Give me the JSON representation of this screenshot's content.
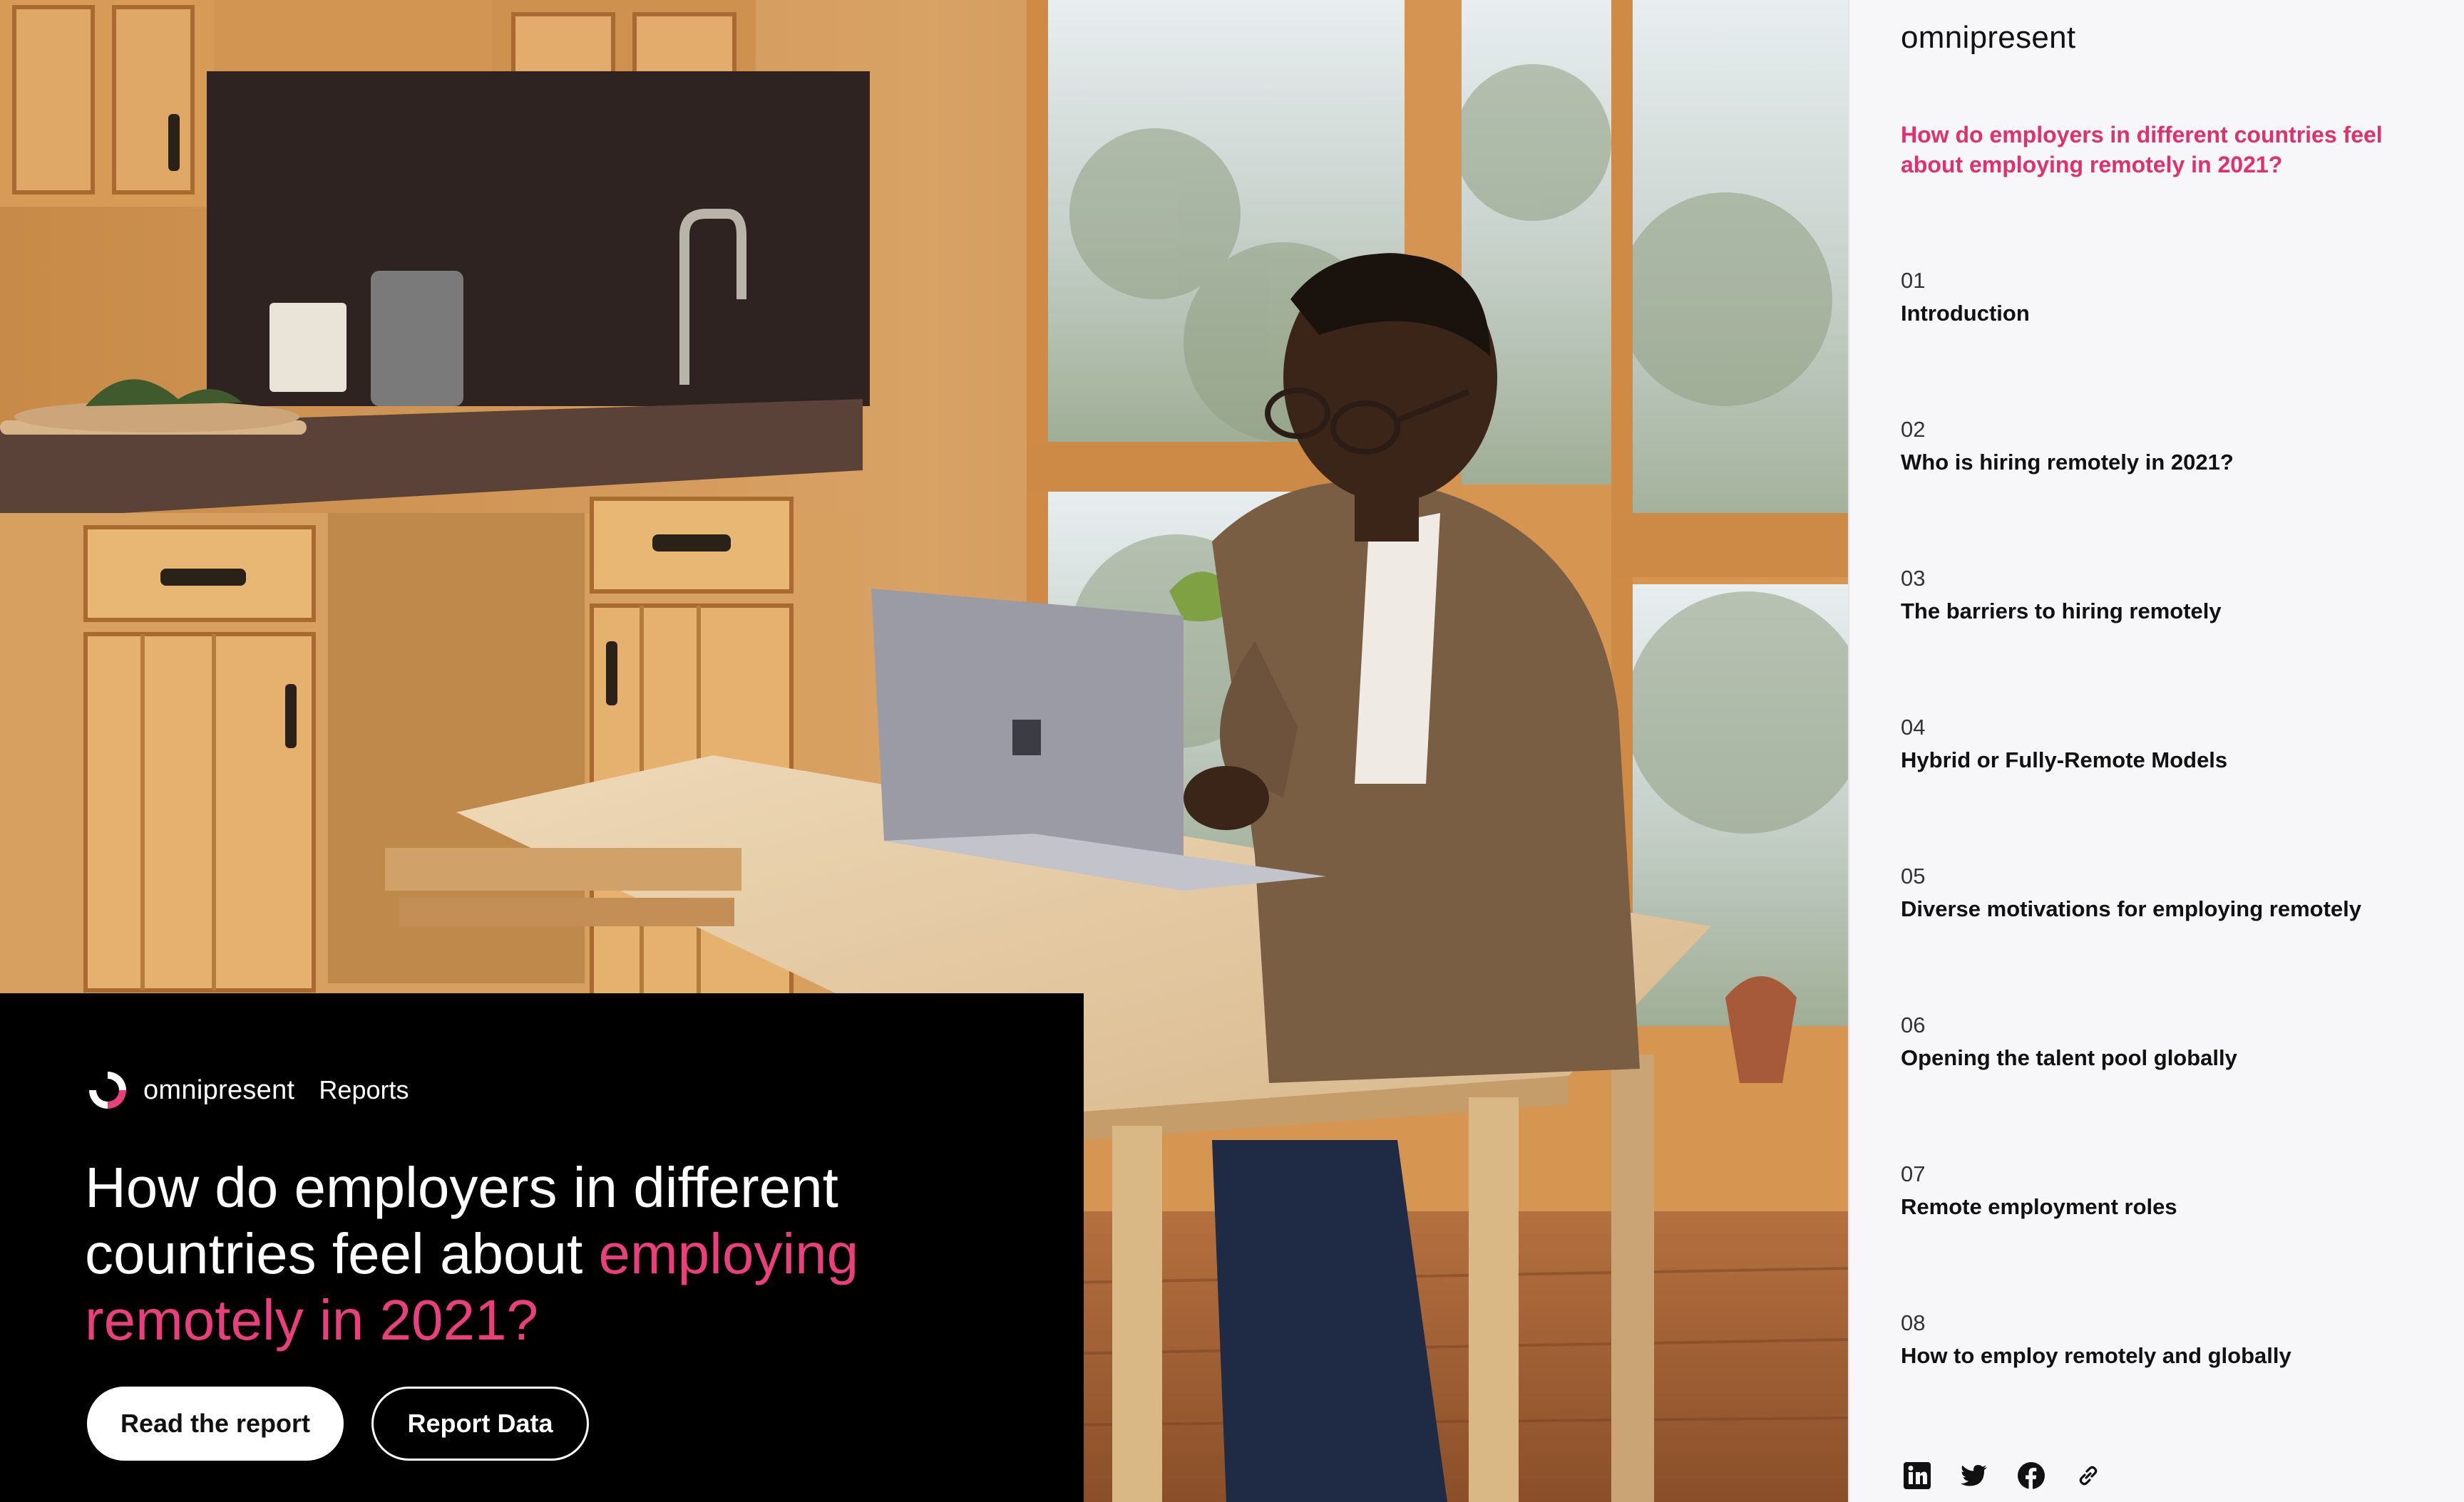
{
  "hero": {
    "brand_name": "omnipresent",
    "brand_section": "Reports",
    "headline_part1": "How do employers in different countries feel about ",
    "headline_accent": "employing remotely in 2021?",
    "primary_button": "Read the report",
    "secondary_button": "Report Data"
  },
  "sidebar": {
    "brand": "omnipresent",
    "current_title": "How do employers in different countries feel about employing remotely in 2021?",
    "items": [
      {
        "num": "01",
        "title": "Introduction"
      },
      {
        "num": "02",
        "title": "Who is hiring remotely in 2021?"
      },
      {
        "num": "03",
        "title": "The barriers to hiring remotely"
      },
      {
        "num": "04",
        "title": "Hybrid or Fully-Remote Models"
      },
      {
        "num": "05",
        "title": "Diverse motivations for employing remotely"
      },
      {
        "num": "06",
        "title": "Opening the talent pool globally"
      },
      {
        "num": "07",
        "title": "Remote employment roles"
      },
      {
        "num": "08",
        "title": "How to employ remotely and globally"
      }
    ],
    "social": [
      "linkedin-icon",
      "twitter-icon",
      "facebook-icon",
      "link-icon"
    ]
  },
  "colors": {
    "accent": "#ea3f7d",
    "sidebar_accent": "#e0306e",
    "overlay": "#000000",
    "sidebar_bg": "#f7f6f8"
  }
}
